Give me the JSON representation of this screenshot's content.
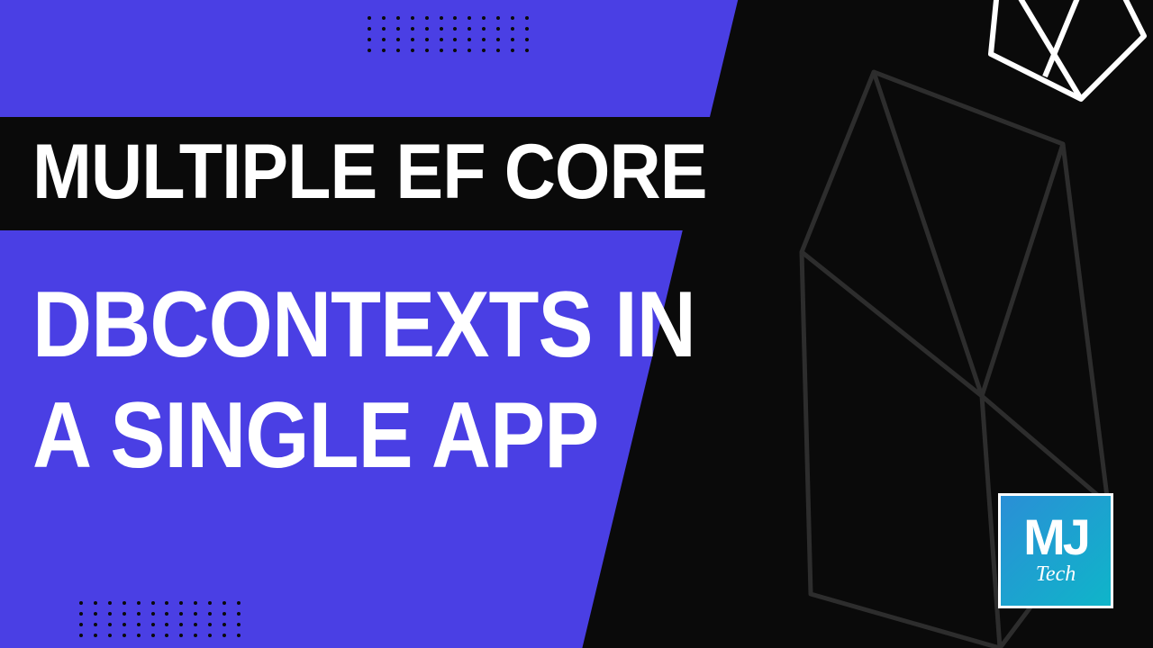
{
  "title": {
    "line1": "MULTIPLE EF CORE"
  },
  "subtitle": {
    "line1": "DBCONTEXTS IN",
    "line2": "A SINGLE APP"
  },
  "logo": {
    "initials": "MJ",
    "label": "Tech"
  },
  "colors": {
    "background": "#4a3fe4",
    "black": "#0a0a0a",
    "white": "#ffffff",
    "logo_gradient_start": "#2a8fd6",
    "logo_gradient_end": "#0fb5c9"
  }
}
